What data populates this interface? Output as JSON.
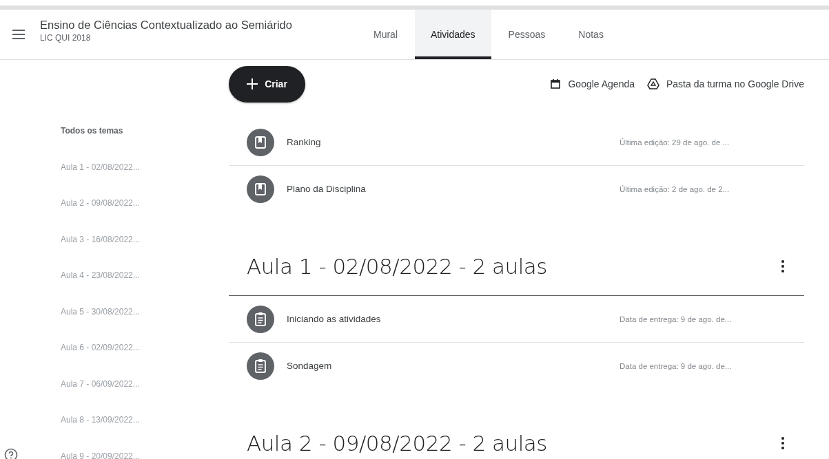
{
  "header": {
    "title": "Ensino de Ciências Contextualizado ao Semiárido",
    "subtitle": "LIC QUI 2018"
  },
  "tabs": [
    {
      "label": "Mural",
      "selected": false
    },
    {
      "label": "Atividades",
      "selected": true
    },
    {
      "label": "Pessoas",
      "selected": false
    },
    {
      "label": "Notas",
      "selected": false
    }
  ],
  "create_button": {
    "label": "Criar"
  },
  "links": [
    {
      "kind": "calendar",
      "label": "Google Agenda"
    },
    {
      "kind": "drive",
      "label": "Pasta da turma no Google Drive"
    }
  ],
  "sidebar": {
    "items": [
      {
        "label": "Todos os temas",
        "selected": true
      },
      {
        "label": "Aula 1 - 02/08/2022...",
        "selected": false
      },
      {
        "label": "Aula 2 - 09/08/2022...",
        "selected": false
      },
      {
        "label": "Aula 3 - 16/08/2022...",
        "selected": false
      },
      {
        "label": "Aula 4 - 23/08/2022...",
        "selected": false
      },
      {
        "label": "Aula 5 - 30/08/2022...",
        "selected": false
      },
      {
        "label": "Aula 6 - 02/09/2022...",
        "selected": false
      },
      {
        "label": "Aula 7 - 06/09/2022...",
        "selected": false
      },
      {
        "label": "Aula 8 - 13/09/2022...",
        "selected": false
      },
      {
        "label": "Aula 9 - 20/09/2022...",
        "selected": false
      }
    ]
  },
  "items": [
    {
      "kind": "material",
      "title": "Ranking",
      "meta": "Última edição: 29 de ago. de ..."
    },
    {
      "kind": "material",
      "title": "Plano da Disciplina",
      "meta": "Última edição: 2 de ago. de 2..."
    }
  ],
  "topics": [
    {
      "title": "Aula 1 - 02/08/2022 - 2 aulas",
      "items": [
        {
          "kind": "assignment",
          "title": "Iniciando as atividades",
          "meta": "Data de entrega: 9 de ago. de..."
        },
        {
          "kind": "assignment",
          "title": "Sondagem",
          "meta": "Data de entrega: 9 de ago. de..."
        }
      ]
    },
    {
      "title": "Aula 2 - 09/08/2022 - 2 aulas"
    }
  ]
}
